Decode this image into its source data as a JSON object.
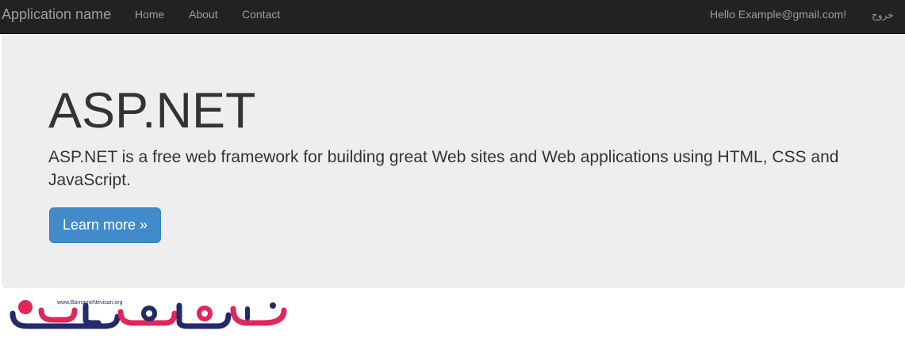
{
  "navbar": {
    "brand": "Application name",
    "links": [
      "Home",
      "About",
      "Contact"
    ],
    "greeting": "Hello Example@gmail.com!",
    "logout": "خروج"
  },
  "jumbotron": {
    "title": "ASP.NET",
    "lead": "ASP.NET is a free web framework for building great Web sites and Web applications using HTML, CSS and JavaScript.",
    "button": "Learn more »"
  },
  "watermark": {
    "url": "www.BarnameNevisan.org",
    "colors": {
      "red": "#e1265a",
      "navy": "#252a6b"
    }
  }
}
